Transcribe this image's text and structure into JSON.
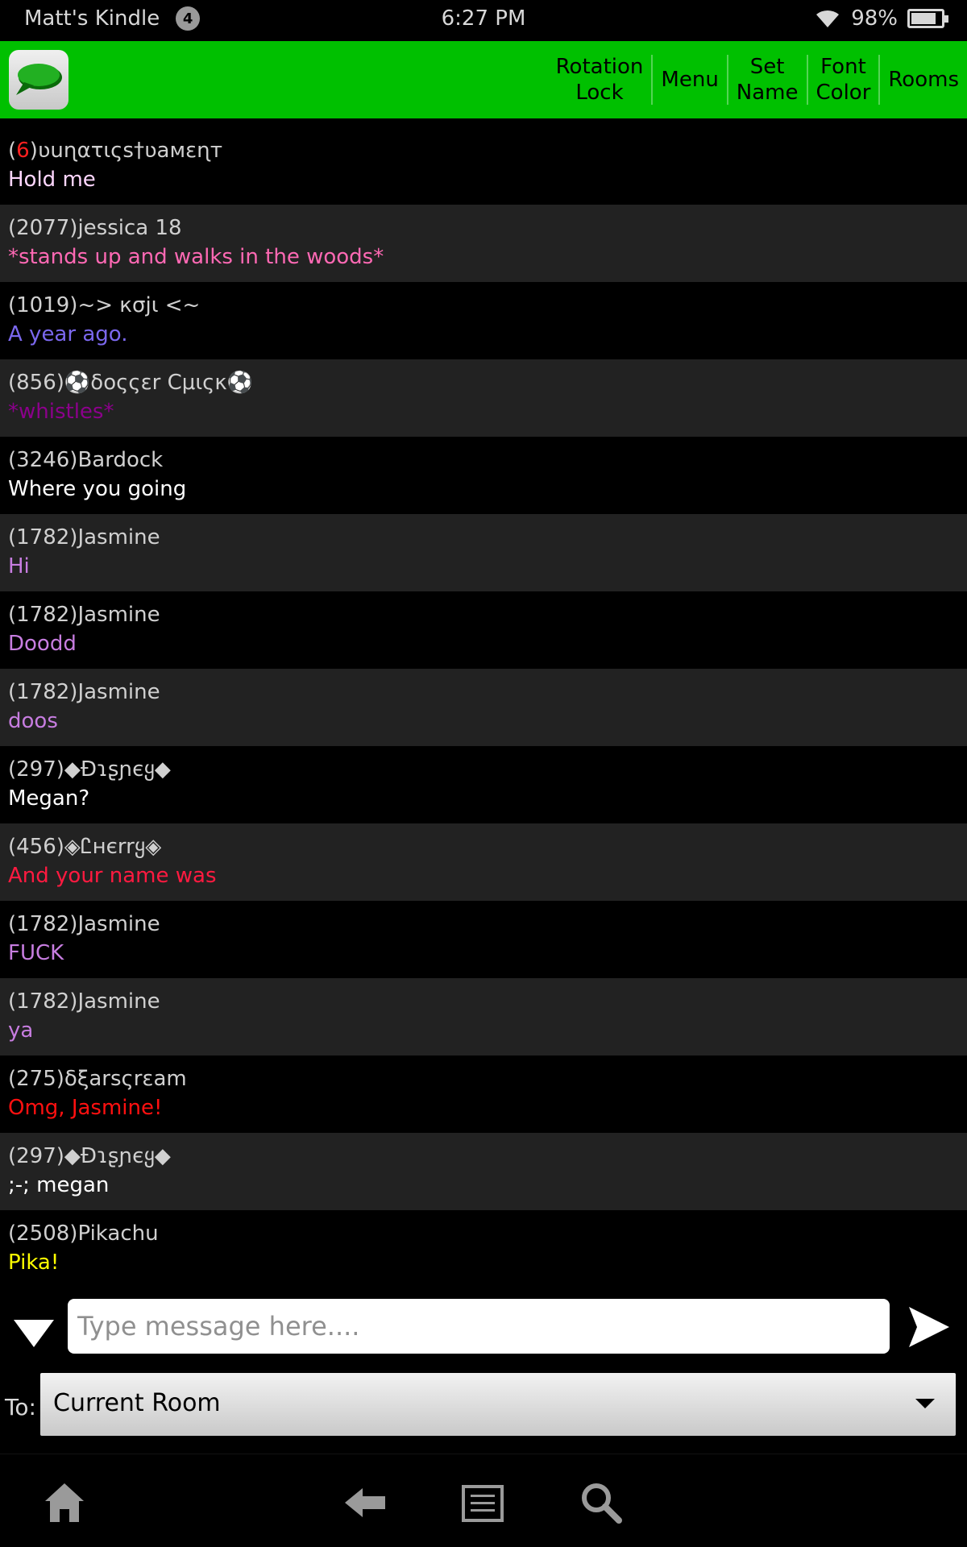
{
  "status_bar": {
    "device_name": "Matt's Kindle",
    "notification_count": "4",
    "time": "6:27 PM",
    "battery_percent": "98%"
  },
  "app_bar": {
    "logo_icon": "speech-bubble-icon",
    "buttons": [
      {
        "line1": "Rotation",
        "line2": "Lock"
      },
      {
        "line1": "Menu",
        "line2": ""
      },
      {
        "line1": "Set",
        "line2": "Name"
      },
      {
        "line1": "Font",
        "line2": "Color"
      },
      {
        "line1": "Rooms",
        "line2": ""
      }
    ]
  },
  "messages": [
    {
      "badge": "(6)",
      "user_badge": "6",
      "user": "ʋuɳατιςs†ʋaмεɳт",
      "text": "Hold me",
      "color": "#ffd6ff"
    },
    {
      "user": "(2077)jessica 18",
      "text": "*stands up and walks in the woods*",
      "color": "#ff69b4"
    },
    {
      "user": "(1019)~> кσјι <~",
      "text": "A year ago.",
      "color": "#7b68ee"
    },
    {
      "user": "(856)⚽δοςςεr Cμιςκ⚽",
      "text": "*whistles*",
      "color": "#8b008b"
    },
    {
      "user": "(3246)Bardock",
      "text": "Where you going",
      "color": "#ffffff"
    },
    {
      "user": "(1782)Jasmine",
      "text": "Hi",
      "color": "#c77de0"
    },
    {
      "user": "(1782)Jasmine",
      "text": "Doodd",
      "color": "#c77de0"
    },
    {
      "user": "(1782)Jasmine",
      "text": "doos",
      "color": "#c77de0"
    },
    {
      "user": "(297)◆Ɖɿʂɲєყ◆",
      "text": "Megan?",
      "color": "#ffffff"
    },
    {
      "user": "(456)◈Ꮭнєrrყ◈",
      "text": "And your name was",
      "color": "#ff1a40"
    },
    {
      "user": "(1782)Jasmine",
      "text": "FUCK",
      "color": "#c77de0"
    },
    {
      "user": "(1782)Jasmine",
      "text": "ya",
      "color": "#c77de0"
    },
    {
      "user": "(275)δξarsςrεam",
      "text": "Omg, Jasmine!",
      "color": "#ff1010"
    },
    {
      "user": "(297)◆Ɖɿʂɲєყ◆",
      "text": ";-; megan",
      "color": "#ffffff"
    },
    {
      "user": "(2508)Pikachu",
      "text": "Pika!",
      "color": "#ffff00"
    }
  ],
  "composer": {
    "placeholder": "Type message here....",
    "value": ""
  },
  "recipient": {
    "label": "To:",
    "selected": "Current Room"
  },
  "nav_bar": {
    "icons": [
      "home-icon",
      "back-icon",
      "menu-icon",
      "search-icon"
    ]
  },
  "colors": {
    "app_bar_green": "#00c000",
    "row_alt": "#222222"
  }
}
